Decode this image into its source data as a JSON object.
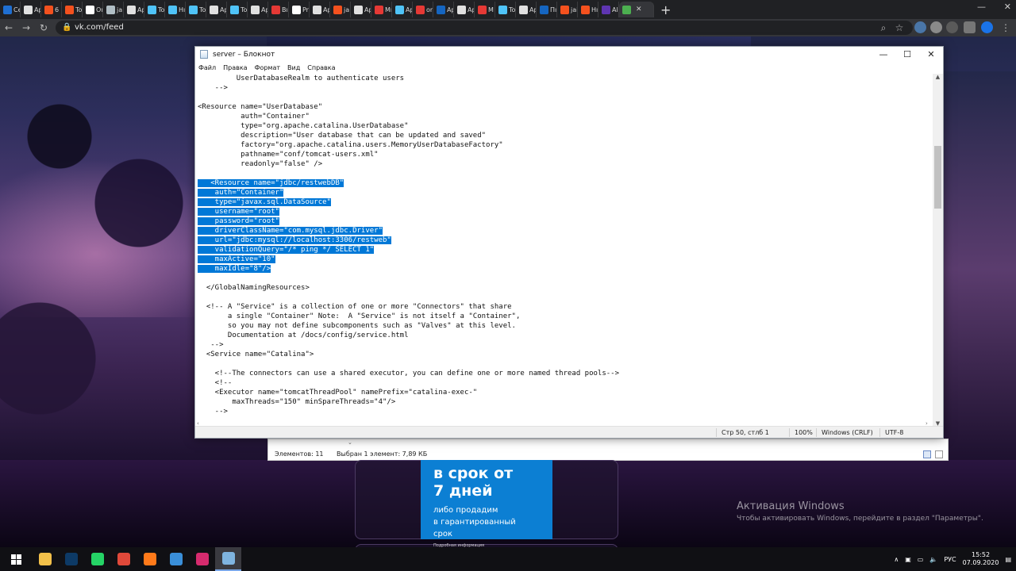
{
  "browser": {
    "tabs": [
      {
        "label": "Ce",
        "color": "#1f6fd1"
      },
      {
        "label": "Ap",
        "color": "#e0e0e0"
      },
      {
        "label": "6 i",
        "color": "#f4511e"
      },
      {
        "label": "To",
        "color": "#f4511e"
      },
      {
        "label": "Oı",
        "color": "#ffffff"
      },
      {
        "label": "ja",
        "color": "#b0bec5"
      },
      {
        "label": "Ap",
        "color": "#e0e0e0"
      },
      {
        "label": "To",
        "color": "#4fc3f7"
      },
      {
        "label": "Hı",
        "color": "#4fc3f7"
      },
      {
        "label": "To",
        "color": "#4fc3f7"
      },
      {
        "label": "Ap",
        "color": "#e0e0e0"
      },
      {
        "label": "To",
        "color": "#4fc3f7"
      },
      {
        "label": "Ap",
        "color": "#e0e0e0"
      },
      {
        "label": "Bı",
        "color": "#e53935"
      },
      {
        "label": "Pr",
        "color": "#ffffff"
      },
      {
        "label": "Ap",
        "color": "#e0e0e0"
      },
      {
        "label": "ja",
        "color": "#f4511e"
      },
      {
        "label": "Ap",
        "color": "#e0e0e0"
      },
      {
        "label": "Mı",
        "color": "#e53935"
      },
      {
        "label": "Ap",
        "color": "#4fc3f7"
      },
      {
        "label": "or",
        "color": "#e53935"
      },
      {
        "label": "Ap",
        "color": "#1565c0"
      },
      {
        "label": "Ap",
        "color": "#e0e0e0"
      },
      {
        "label": "M",
        "color": "#e53935"
      },
      {
        "label": "To",
        "color": "#4fc3f7"
      },
      {
        "label": "Ap",
        "color": "#e0e0e0"
      },
      {
        "label": "Пı",
        "color": "#1565c0"
      },
      {
        "label": "jai",
        "color": "#f4511e"
      },
      {
        "label": "Hı",
        "color": "#f4511e"
      },
      {
        "label": "All",
        "color": "#5e35b1"
      }
    ],
    "active_tab": {
      "label": "",
      "color": "#4caf50"
    },
    "url": "vk.com/feed"
  },
  "notepad": {
    "title": "server – Блокнот",
    "menu": [
      "Файл",
      "Правка",
      "Формат",
      "Вид",
      "Справка"
    ],
    "lines": [
      {
        "text": "         UserDatabaseRealm to authenticate users",
        "sel": false
      },
      {
        "text": "    -->",
        "sel": false
      },
      {
        "text": "",
        "sel": false
      },
      {
        "text": "<Resource name=\"UserDatabase\"",
        "sel": false
      },
      {
        "text": "          auth=\"Container\"",
        "sel": false
      },
      {
        "text": "          type=\"org.apache.catalina.UserDatabase\"",
        "sel": false
      },
      {
        "text": "          description=\"User database that can be updated and saved\"",
        "sel": false
      },
      {
        "text": "          factory=\"org.apache.catalina.users.MemoryUserDatabaseFactory\"",
        "sel": false
      },
      {
        "text": "          pathname=\"conf/tomcat-users.xml\"",
        "sel": false
      },
      {
        "text": "          readonly=\"false\" />",
        "sel": false
      },
      {
        "text": "",
        "sel": false
      },
      {
        "text": "   <Resource name=\"jdbc/restwebDB\"",
        "sel": true
      },
      {
        "text": "    auth=\"Container\"",
        "sel": true
      },
      {
        "text": "    type=\"javax.sql.DataSource\"",
        "sel": true
      },
      {
        "text": "    username=\"root\"",
        "sel": true
      },
      {
        "text": "    password=\"root\"",
        "sel": true
      },
      {
        "text": "    driverClassName=\"com.mysql.jdbc.Driver\"",
        "sel": true
      },
      {
        "text": "    url=\"jdbc:mysql://localhost:3306/restweb\"",
        "sel": true
      },
      {
        "text": "    validationQuery=\"/* ping */ SELECT 1\"",
        "sel": true
      },
      {
        "text": "    maxActive=\"10\"",
        "sel": true
      },
      {
        "text": "    maxIdle=\"8\"/>",
        "sel": true
      },
      {
        "text": "",
        "sel": false
      },
      {
        "text": "  </GlobalNamingResources>",
        "sel": false
      },
      {
        "text": "",
        "sel": false
      },
      {
        "text": "  <!-- A \"Service\" is a collection of one or more \"Connectors\" that share",
        "sel": false
      },
      {
        "text": "       a single \"Container\" Note:  A \"Service\" is not itself a \"Container\",",
        "sel": false
      },
      {
        "text": "       so you may not define subcomponents such as \"Valves\" at this level.",
        "sel": false
      },
      {
        "text": "       Documentation at /docs/config/service.html",
        "sel": false
      },
      {
        "text": "   -->",
        "sel": false
      },
      {
        "text": "  <Service name=\"Catalina\">",
        "sel": false
      },
      {
        "text": "",
        "sel": false
      },
      {
        "text": "    <!--The connectors can use a shared executor, you can define one or more named thread pools-->",
        "sel": false
      },
      {
        "text": "    <!--",
        "sel": false
      },
      {
        "text": "    <Executor name=\"tomcatThreadPool\" namePrefix=\"catalina-exec-\"",
        "sel": false
      },
      {
        "text": "        maxThreads=\"150\" minSpareThreads=\"4\"/>",
        "sel": false
      },
      {
        "text": "    -->",
        "sel": false
      }
    ],
    "status": {
      "position": "Стр 50, стлб 1",
      "zoom": "100%",
      "eol": "Windows (CRLF)",
      "encoding": "UTF-8"
    }
  },
  "explorer": {
    "items_count": "Элементов: 11",
    "selected": "Выбран 1 элемент: 7,89 КБ"
  },
  "ad": {
    "headline_1": "в срок от",
    "headline_2": "7 дней",
    "body_1": "либо продадим",
    "body_2": "в гарантированный",
    "body_3": "срок",
    "footnote": "Подробная информация"
  },
  "activation": {
    "title": "Активация Windows",
    "subtitle": "Чтобы активировать Windows, перейдите в раздел \"Параметры\"."
  },
  "taskbar": {
    "apps": [
      {
        "name": "file-explorer-icon",
        "color": "#f2c04a"
      },
      {
        "name": "photoshop-icon",
        "color": "#0d3a66"
      },
      {
        "name": "whatsapp-icon",
        "color": "#25d366"
      },
      {
        "name": "chrome-icon",
        "color": "#e0493a"
      },
      {
        "name": "firefox-icon",
        "color": "#ff7a1a"
      },
      {
        "name": "chrome-alt-icon",
        "color": "#3a8fd9"
      },
      {
        "name": "intellij-icon",
        "color": "#d62b6e"
      },
      {
        "name": "notepad-icon",
        "color": "#7fb4e0"
      }
    ],
    "language": "РУС",
    "time": "15:52",
    "date": "07.09.2020"
  }
}
